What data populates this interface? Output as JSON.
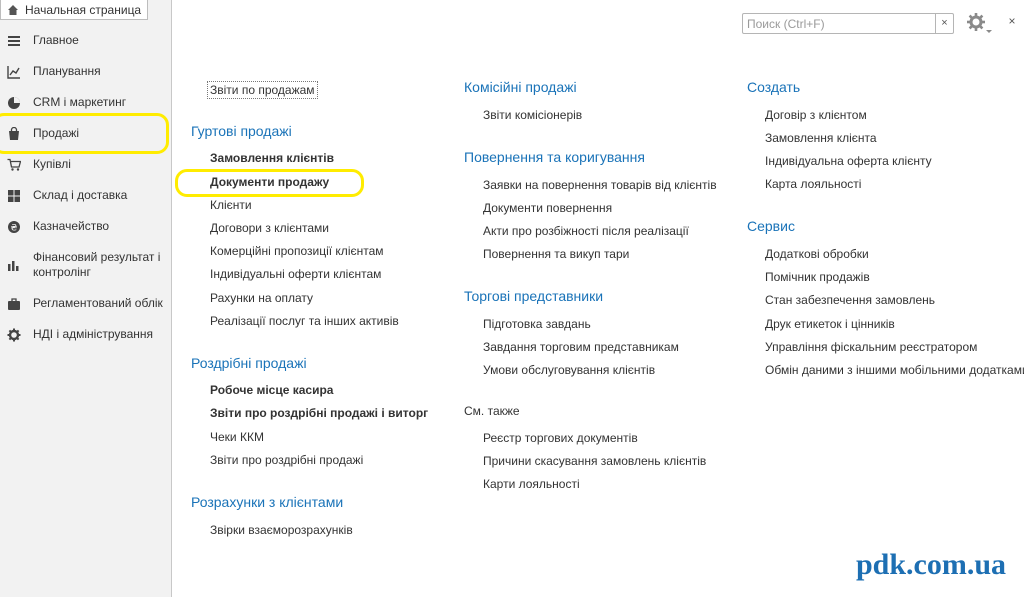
{
  "home_tab": {
    "label": "Начальная страница"
  },
  "sidebar": {
    "items": [
      {
        "label": "Главное"
      },
      {
        "label": "Планування"
      },
      {
        "label": "CRM і маркетинг"
      },
      {
        "label": "Продажі"
      },
      {
        "label": "Купівлі"
      },
      {
        "label": "Склад і доставка"
      },
      {
        "label": "Казначейство"
      },
      {
        "label": "Фінансовий результат і\nконтролінг"
      },
      {
        "label": "Регламентований облік"
      },
      {
        "label": "НДІ і адміністрування"
      }
    ]
  },
  "search": {
    "placeholder": "Поиск (Ctrl+F)",
    "clear": "×"
  },
  "close_label": "×",
  "col1": {
    "top_link": "Звіти по продажам",
    "wholesale": {
      "title": "Гуртові продажі",
      "links": [
        "Замовлення клієнтів",
        "Документи продажу",
        "Клієнти",
        "Договори з клієнтами",
        "Комерційні пропозиції клієнтам",
        "Індивідуальні оферти клієнтам",
        "Рахунки на оплату",
        "Реалізації послуг та інших активів"
      ]
    },
    "retail": {
      "title": "Роздрібні продажі",
      "links": [
        "Робоче місце касира",
        "Звіти про роздрібні продажі і виторг",
        "Чеки ККМ",
        "Звіти про роздрібні продажі"
      ]
    },
    "settlements": {
      "title": "Розрахунки з клієнтами",
      "links": [
        "Звірки взаєморозрахунків"
      ]
    }
  },
  "col2": {
    "commission": {
      "title": "Комісійні продажі",
      "links": [
        "Звіти комісіонерів"
      ]
    },
    "returns": {
      "title": "Повернення та коригування",
      "links": [
        "Заявки на повернення товарів від клієнтів",
        "Документи повернення",
        "Акти про розбіжності після реалізації",
        "Повернення та викуп тари"
      ]
    },
    "agents": {
      "title": "Торгові представники",
      "links": [
        "Підготовка завдань",
        "Завдання торговим представникам",
        "Умови обслуговування клієнтів"
      ]
    },
    "see_also": {
      "title": "См. также",
      "links": [
        "Реєстр торгових документів",
        "Причини скасування замовлень клієнтів",
        "Карти лояльності"
      ]
    }
  },
  "col3": {
    "create": {
      "title": "Создать",
      "links": [
        "Договір з клієнтом",
        "Замовлення клієнта",
        "Індивідуальна оферта клієнту",
        "Карта лояльності"
      ]
    },
    "service": {
      "title": "Сервис",
      "links": [
        "Додаткові обробки",
        "Помічник продажів",
        "Стан забезпечення замовлень",
        "Друк етикеток і цінників",
        "Управління фіскальним реєстратором",
        "Обмін даними з іншими мобільними додатками"
      ]
    }
  },
  "watermark": "pdk.com.ua"
}
